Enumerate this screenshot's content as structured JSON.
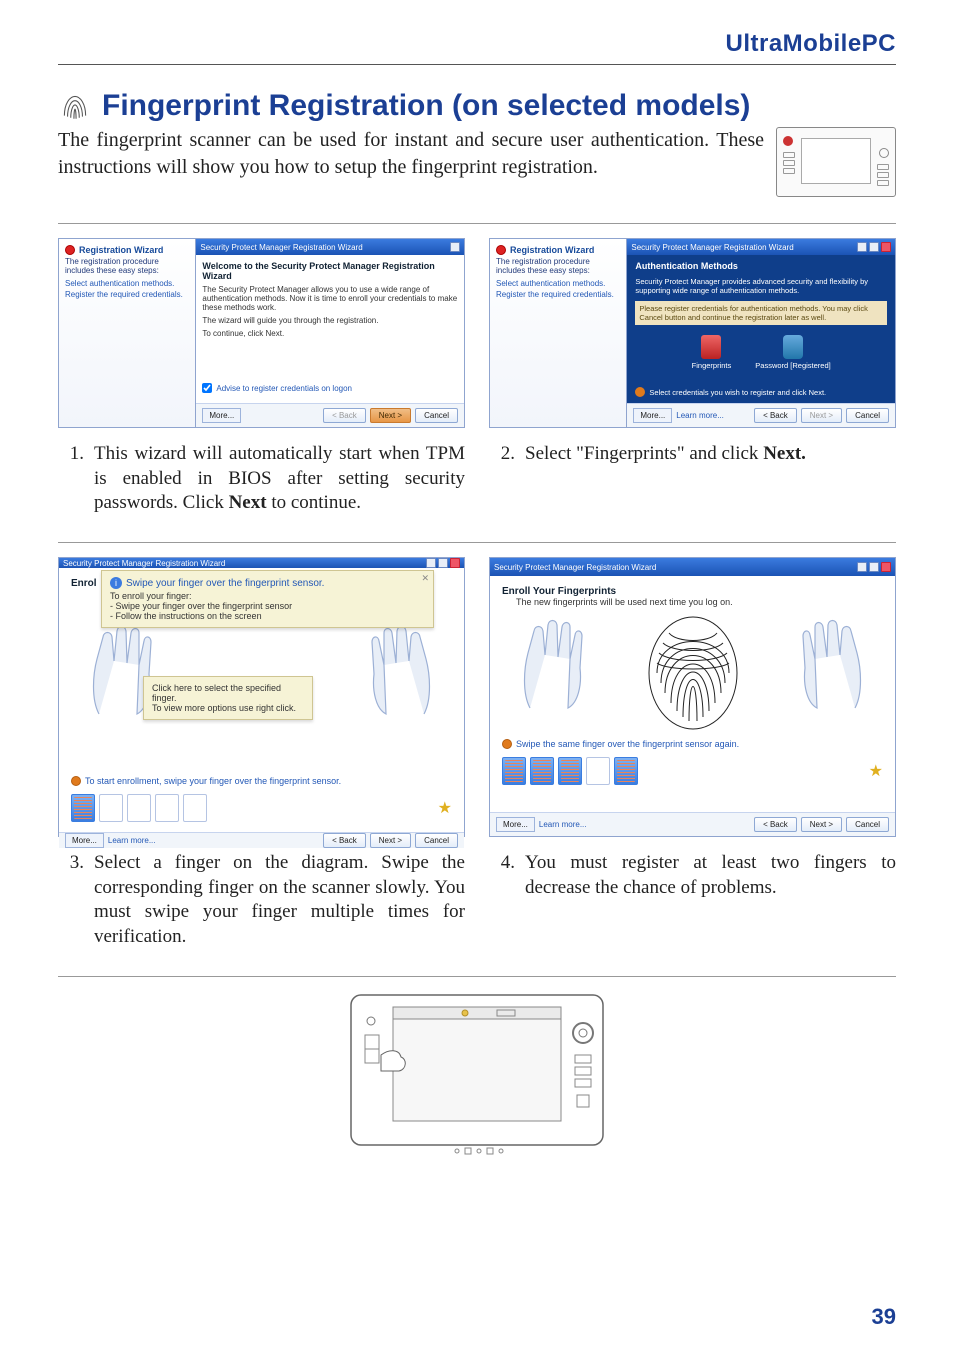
{
  "doc_title": "UltraMobilePC",
  "section_title": "Fingerprint Registration (on selected models)",
  "intro": "The fingerprint scanner can be used for instant and secure user authentication. These instructions will show you how to setup the fingerprint registration.",
  "steps": [
    {
      "num": "1.",
      "before": "This wizard will automatically start when TPM is enabled in BIOS after setting security passwords. Click ",
      "bold": "Next",
      "after": " to continue."
    },
    {
      "num": "2.",
      "before": "Select \"Fingerprints\" and click ",
      "bold": "Next.",
      "after": ""
    },
    {
      "num": "3.",
      "before": "Select a finger on the diagram. Swipe the corresponding finger on the scanner slowly. You must swipe your finger multiple times for verification.",
      "bold": "",
      "after": ""
    },
    {
      "num": "4.",
      "before": "You must register at least two fingers to decrease the chance of problems.",
      "bold": "",
      "after": ""
    }
  ],
  "shot1": {
    "titlebar": "Security Protect Manager Registration Wizard",
    "sidebar_title": "Registration Wizard",
    "sidebar_sub": "The registration procedure includes these easy steps:",
    "sidebar_items": [
      "Select authentication methods.",
      "Register the required credentials."
    ],
    "headline": "Welcome to the Security Protect Manager Registration Wizard",
    "body1": "The Security Protect Manager allows you to use a wide range of authentication methods. Now it is time to enroll your credentials to make these methods work.",
    "body2": "The wizard will guide you through the registration.",
    "body3": "To continue, click Next.",
    "checkbox": "Advise to register credentials on logon",
    "more": "More...",
    "back": "< Back",
    "next": "Next >",
    "cancel": "Cancel"
  },
  "shot2": {
    "titlebar": "Security Protect Manager Registration Wizard",
    "sidebar_title": "Registration Wizard",
    "sidebar_sub": "The registration procedure includes these easy steps:",
    "sidebar_items": [
      "Select authentication methods.",
      "Register the required credentials."
    ],
    "auth_title": "Authentication Methods",
    "auth_sub": "Security Protect Manager provides advanced security and flexibility by supporting wide range of authentication methods.",
    "hint": "Please register credentials for authentication methods. You may click Cancel button and continue the registration later as well.",
    "fp_label": "Fingerprints",
    "pw_label": "Password [Registered]",
    "select_hint": "Select credentials you wish to register and click Next.",
    "more": "More...",
    "learn": "Learn more...",
    "back": "< Back",
    "next": "Next >",
    "cancel": "Cancel"
  },
  "shot3": {
    "titlebar": "Security Protect Manager Registration Wizard",
    "enrol_prefix": "Enrol",
    "tooltip_title": "Swipe your finger over the fingerprint sensor.",
    "tooltip_lead": "To enroll your finger:",
    "tooltip_l1": "- Swipe your finger over the fingerprint sensor",
    "tooltip_l2": "- Follow the instructions on the screen",
    "tooltip2_l1": "Click here to select the specified finger.",
    "tooltip2_l2": "To view more options use right click.",
    "start_hint": "To start enrollment, swipe your finger over the fingerprint sensor.",
    "more": "More...",
    "learn": "Learn more...",
    "back": "< Back",
    "next": "Next >",
    "cancel": "Cancel"
  },
  "shot4": {
    "titlebar": "Security Protect Manager Registration Wizard",
    "etitle": "Enroll Your Fingerprints",
    "esub": "The new fingerprints will be used next time you log on.",
    "swipe_hint": "Swipe the same finger over the fingerprint sensor again.",
    "more": "More...",
    "learn": "Learn more...",
    "back": "< Back",
    "next": "Next >",
    "cancel": "Cancel"
  },
  "page_number": "39"
}
